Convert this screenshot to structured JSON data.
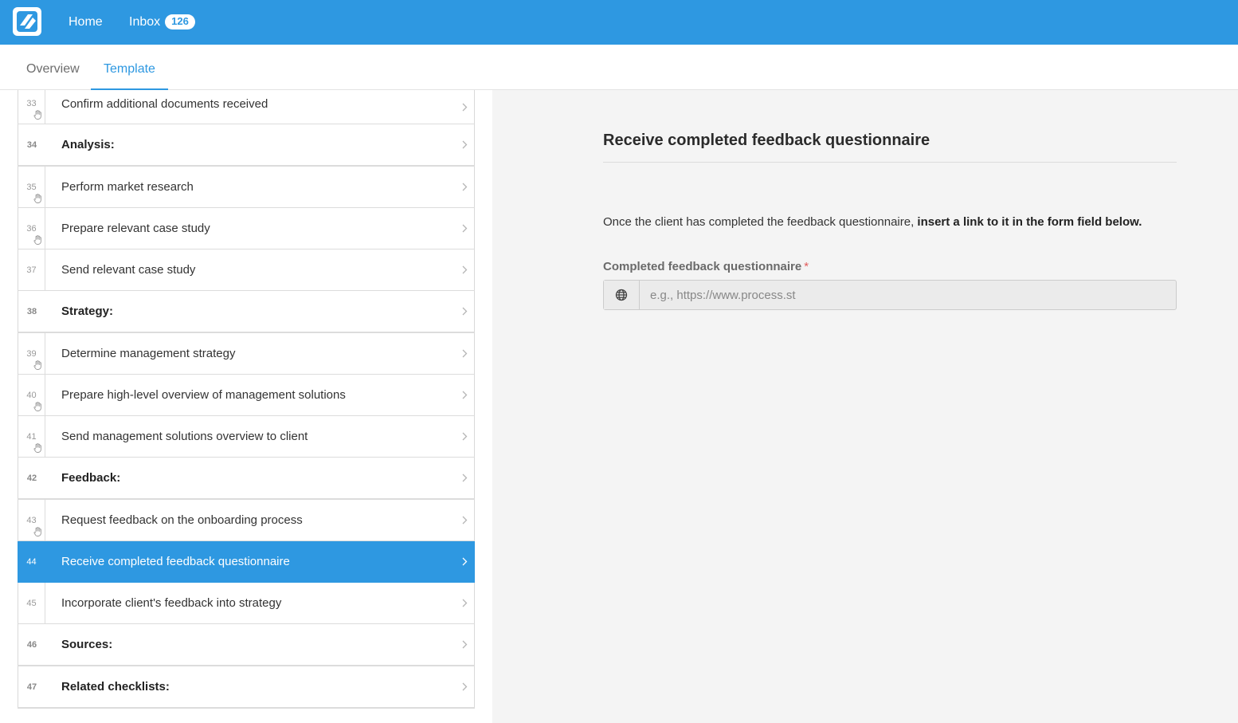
{
  "header": {
    "logo_icon": "process-street-logo",
    "home_label": "Home",
    "inbox_label": "Inbox",
    "inbox_count": "126",
    "brand_color": "#2e98e1"
  },
  "tabs": [
    {
      "label": "Overview",
      "active": false
    },
    {
      "label": "Template",
      "active": true
    }
  ],
  "tasks": [
    {
      "num": "33",
      "label": "Confirm additional documents received",
      "heading": false,
      "hand": true
    },
    {
      "num": "34",
      "label": "Analysis:",
      "heading": true,
      "hand": false
    },
    {
      "num": "35",
      "label": "Perform market research",
      "heading": false,
      "hand": true
    },
    {
      "num": "36",
      "label": "Prepare relevant case study",
      "heading": false,
      "hand": true
    },
    {
      "num": "37",
      "label": "Send relevant case study",
      "heading": false,
      "hand": false
    },
    {
      "num": "38",
      "label": "Strategy:",
      "heading": true,
      "hand": false
    },
    {
      "num": "39",
      "label": "Determine management strategy",
      "heading": false,
      "hand": true
    },
    {
      "num": "40",
      "label": "Prepare high-level overview of management solutions",
      "heading": false,
      "hand": true
    },
    {
      "num": "41",
      "label": "Send management solutions overview to client",
      "heading": false,
      "hand": true
    },
    {
      "num": "42",
      "label": "Feedback:",
      "heading": true,
      "hand": false
    },
    {
      "num": "43",
      "label": "Request feedback on the onboarding process",
      "heading": false,
      "hand": true
    },
    {
      "num": "44",
      "label": "Receive completed feedback questionnaire",
      "heading": false,
      "hand": false,
      "active": true
    },
    {
      "num": "45",
      "label": "Incorporate client's feedback into strategy",
      "heading": false,
      "hand": false
    },
    {
      "num": "46",
      "label": "Sources:",
      "heading": true,
      "hand": false
    },
    {
      "num": "47",
      "label": "Related checklists:",
      "heading": true,
      "hand": false
    }
  ],
  "detail": {
    "title": "Receive completed feedback questionnaire",
    "instruction_plain": "Once the client has completed the feedback questionnaire, ",
    "instruction_bold": "insert a link to it in the form field below.",
    "field_label": "Completed feedback questionnaire",
    "required_mark": "*",
    "field_icon": "globe-icon",
    "field_placeholder": "e.g., https://www.process.st",
    "field_value": ""
  }
}
